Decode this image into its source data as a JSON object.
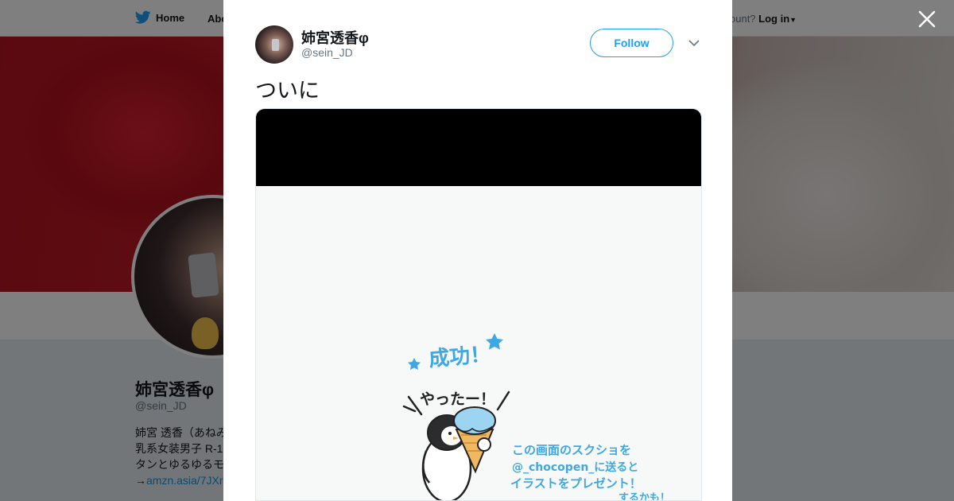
{
  "nav": {
    "home_label": "Home",
    "about_label": "Abo",
    "account_prompt": "ccount?",
    "login_label": "Log in"
  },
  "profile": {
    "name": "姉宮透香φ",
    "handle": "@sein_JD",
    "bio_lines": [
      "姉宮 透香（あねみ",
      "乳系女装男子 R-1",
      "タンとゆるゆるモ"
    ],
    "bio_link_prefix": "→",
    "bio_link": "amzn.asia/7JXr"
  },
  "tweet": {
    "author_name": "姉宮透香φ",
    "author_handle": "@sein_JD",
    "follow_label": "Follow",
    "text": "ついに"
  },
  "illustration": {
    "success_text": "成功！",
    "shout_text": "やったー！",
    "message_line1": "この画面のスクショを",
    "message_line2": "@_chocopen_に送ると",
    "message_line3": "イラストをプレゼント！",
    "message_line4": "するかも！"
  },
  "colors": {
    "accent": "#1da1f2",
    "link": "#1b95e0",
    "illustration_blue": "#3fa7e3"
  },
  "icons": {
    "bird": "twitter-bird-icon",
    "close": "close-icon",
    "caret": "chevron-down-icon"
  }
}
